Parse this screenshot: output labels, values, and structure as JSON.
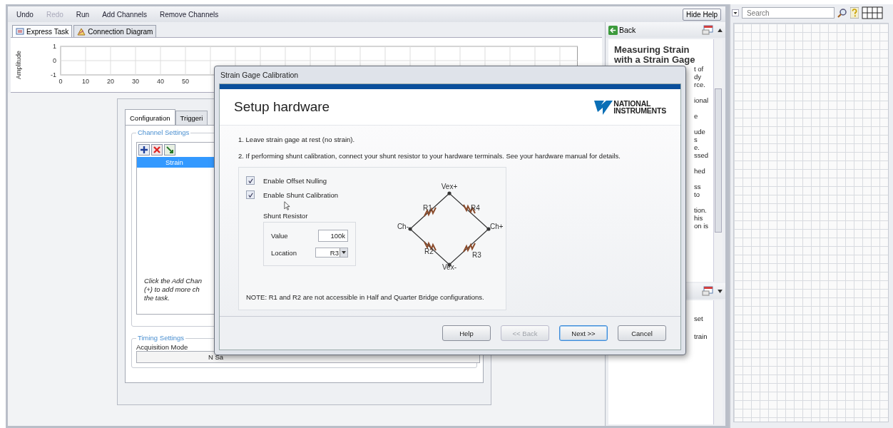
{
  "toolbar": {
    "items": [
      {
        "label": "Undo",
        "disabled": false
      },
      {
        "label": "Redo",
        "disabled": true
      },
      {
        "label": "Run",
        "disabled": false
      },
      {
        "label": "Add Channels",
        "disabled": false
      },
      {
        "label": "Remove Channels",
        "disabled": false
      }
    ],
    "hide_help": "Hide Help"
  },
  "tabs": [
    {
      "label": "Express Task",
      "selected": true
    },
    {
      "label": "Connection Diagram",
      "selected": false
    }
  ],
  "chart": {
    "chart_data": {
      "type": "line",
      "ylabel": "Amplitude",
      "xticks": [
        0,
        10,
        20,
        30,
        40,
        50
      ],
      "yticks": [
        -1,
        0,
        1
      ],
      "xlim": [
        0,
        207
      ],
      "ylim": [
        -1,
        1
      ],
      "grid": true
    }
  },
  "config": {
    "tabs": [
      {
        "label": "Configuration",
        "selected": true
      },
      {
        "label": "Triggeri",
        "selected": false
      }
    ],
    "channel_settings": {
      "title": "Channel Settings",
      "channels": [
        {
          "name": "Strain",
          "selected": true
        }
      ],
      "hint": [
        "Click the Add Chan",
        "(+) to add more ch",
        "the task."
      ]
    },
    "timing_settings": {
      "title": "Timing Settings",
      "acquisition_mode_label": "Acquisition Mode",
      "acquisition_mode": "N Sa"
    }
  },
  "help": {
    "back": "Back",
    "title": [
      "Measuring Strain",
      "with a Strain Gage"
    ],
    "fragments": [
      [
        "t of",
        "dy",
        "rce."
      ],
      [
        "ional"
      ],
      [
        "e"
      ],
      [
        "ude",
        "s",
        "e.",
        "ssed"
      ],
      [
        "hed"
      ],
      [
        "ss",
        "to"
      ],
      [
        "tion.",
        "his",
        "on is"
      ]
    ],
    "lower_fragments": [
      "set",
      "train"
    ]
  },
  "palette": {
    "search": {
      "placeholder": "Search"
    }
  },
  "dialog": {
    "title": "Strain Gage Calibration",
    "heading": "Setup hardware",
    "logo": [
      "NATIONAL",
      "INSTRUMENTS"
    ],
    "steps": [
      "1. Leave strain gage at rest (no strain).",
      "2. If performing shunt calibration, connect your shunt resistor to your hardware terminals. See your hardware manual for details."
    ],
    "options": [
      {
        "label": "Enable Offset Nulling",
        "checked": true
      },
      {
        "label": "Enable Shunt Calibration",
        "checked": true
      }
    ],
    "shunt_resistor": {
      "title": "Shunt Resistor",
      "value_label": "Value",
      "value": "100k",
      "location_label": "Location",
      "location": "R3"
    },
    "bridge_labels": [
      "Vex+",
      "R1",
      "R4",
      "Ch-",
      "Ch+",
      "R2",
      "R3",
      "Vex-"
    ],
    "note": "NOTE: R1 and R2 are not accessible in Half and Quarter Bridge configurations.",
    "buttons": [
      {
        "label": "Help",
        "disabled": false,
        "default": false
      },
      {
        "label": "<< Back",
        "disabled": true,
        "default": false
      },
      {
        "label": "Next >>",
        "disabled": false,
        "default": true
      },
      {
        "label": "Cancel",
        "disabled": false,
        "default": false
      }
    ]
  }
}
